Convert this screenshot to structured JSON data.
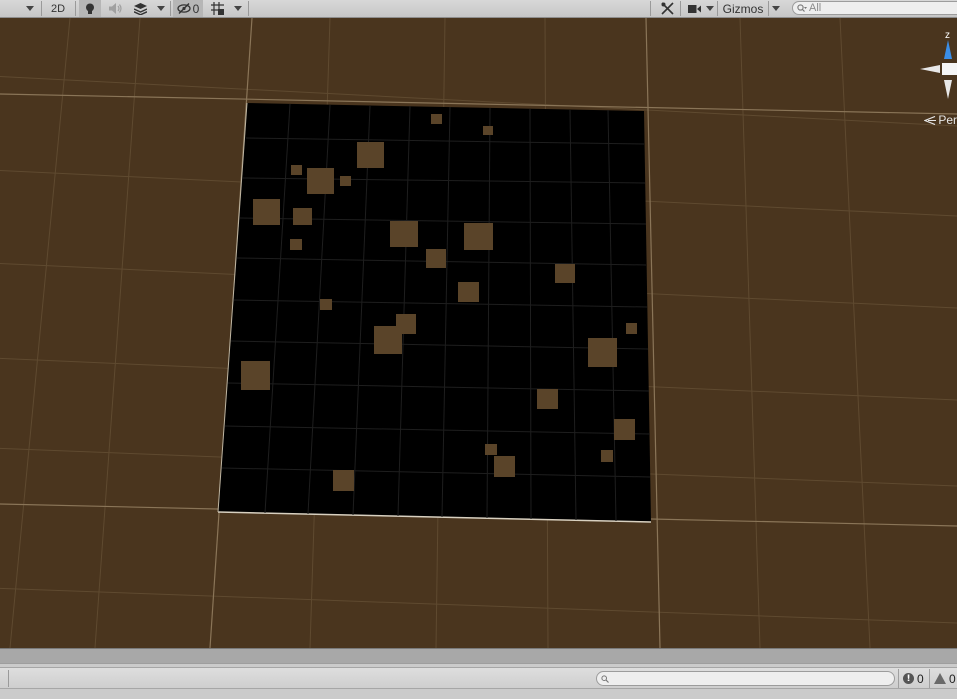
{
  "toolbar": {
    "mode_2d_label": "2D",
    "hidden_objects_count": "0",
    "gizmos_label": "Gizmos",
    "search_placeholder": "All",
    "icons": {
      "lighting": "lightbulb-icon",
      "audio": "speaker-icon",
      "effects": "layers-icon",
      "hidden": "eye-slash-icon",
      "grid": "grid-icon",
      "tools": "tools-icon",
      "camera": "camera-icon",
      "search": "search-icon"
    }
  },
  "viewport": {
    "background_color": "#4a351e",
    "plane_color": "#000000",
    "tile_color": "#5a4429",
    "projection_label": "Per",
    "gizmo_axis_label": "z",
    "gizmo_axis_color": "#3a8ee8"
  },
  "console": {
    "search_placeholder": "",
    "info_count": "0",
    "warning_count": "0"
  }
}
